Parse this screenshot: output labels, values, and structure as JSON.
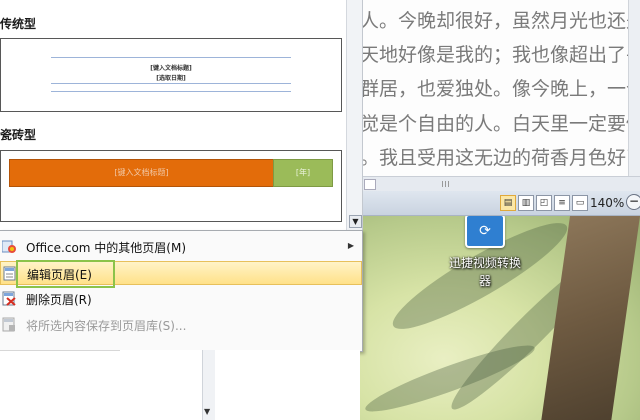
{
  "document": {
    "lines": [
      "人。今晚却很好，虽然月光也还是淡淡",
      "天地好像是我的；我也像超出了平常",
      "群居，也爱独处。像今晚上，一个人",
      "觉是个自由的人。白天里一定要做的",
      "。我且受用这无边的荷香月色好了。"
    ]
  },
  "statusbar": {
    "zoom": "140%",
    "zoom_out": "−"
  },
  "gallery": {
    "section1_title": "传统型",
    "section1_title_placeholder": "[键入文档标题]",
    "section1_date_placeholder": "[选取日期]",
    "section2_title": "瓷砖型",
    "section2_title_placeholder": "[键入文档标题]",
    "section2_year_placeholder": "[年]"
  },
  "menu": {
    "items": [
      {
        "label": "Office.com 中的其他页眉(M)",
        "enabled": true,
        "has_submenu": true
      },
      {
        "label": "编辑页眉(E)",
        "enabled": true,
        "hover": true
      },
      {
        "label": "删除页眉(R)",
        "enabled": true
      },
      {
        "label": "将所选内容保存到页眉库(S)...",
        "enabled": false
      }
    ]
  },
  "desktop": {
    "icon_label": "迅捷视频转换器"
  },
  "colors": {
    "accent_orange": "#e36c0a",
    "accent_green": "#9bbb59",
    "hover_yellow": "#ffe189",
    "highlight_box": "#8bc34a"
  }
}
